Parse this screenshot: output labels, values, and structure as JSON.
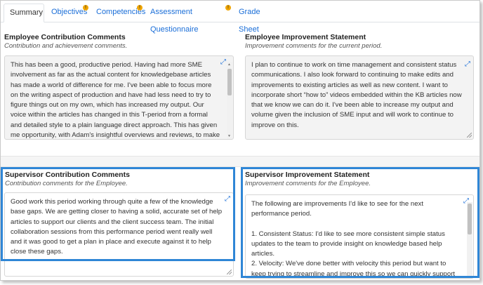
{
  "tabs": [
    {
      "label": "Summary",
      "active": true,
      "badge": ""
    },
    {
      "label": "Objectives",
      "active": false,
      "badge": "!"
    },
    {
      "label": "Competencies",
      "active": false,
      "badge": "!"
    },
    {
      "label": "Assessment Questionnaire",
      "active": false,
      "badge": "!"
    },
    {
      "label": "Grade Sheet",
      "active": false,
      "badge": ""
    }
  ],
  "employee_contribution": {
    "title": "Employee Contribution Comments",
    "subtitle": "Contribution and achievement comments.",
    "text": "This has been a good, productive period. Having had more SME involvement as far as the actual content for knowledgebase articles has made a world of difference for me. I've been able to focus more on the writing aspect of production and have had less need to try to figure things out on my own, which has increased my output. Our voice within the articles has changed in this T-period from a formal and detailed style to a plain language direct approach. This has given me opportunity, with Adam's insightful overviews and reviews, to make"
  },
  "employee_improvement": {
    "title": "Employee Improvement Statement",
    "subtitle": "Improvement comments for the current period.",
    "text": "I plan to continue to work on time management and consistent status communications. I also look forward to continuing to make edits and improvements to existing articles as well as new content.  I want to incorporate short “how to” videos embedded within the KB articles now that we know we can do it. I've been able to increase my output and volume given the inclusion of SME input and will work to continue to improve on this."
  },
  "supervisor_contribution": {
    "title": "Supervisor Contribution Comments",
    "subtitle": "Contribution comments for the Employee.",
    "text": "Good work this period working through quite a few of the knowledge base gaps. We are getting closer to having a solid, accurate set of help articles to support our clients and the client success team. The initial collaboration sessions from this performance period went really well and it was good to get a plan in place and execute against it to help close these gaps."
  },
  "supervisor_improvement": {
    "title": "Supervisor Improvement Statement",
    "subtitle": "Improvement comments for the Employee.",
    "lines": [
      "The following are improvements I'd like to see for the next performance period.",
      "",
      "1. Consistent Status: I'd like to see more consistent simple status updates to the team to provide insight on knowledge based help articles.",
      "2. Velocity: We've done better with velocity this period but want to keep trying to streamline and improve this so we can quickly support"
    ]
  },
  "icons": {
    "expand": "expand-icon",
    "resize": "resize-grip-icon"
  },
  "colors": {
    "accent": "#1a6ed8",
    "highlight": "#2f86d6",
    "badge": "#f0a500"
  }
}
